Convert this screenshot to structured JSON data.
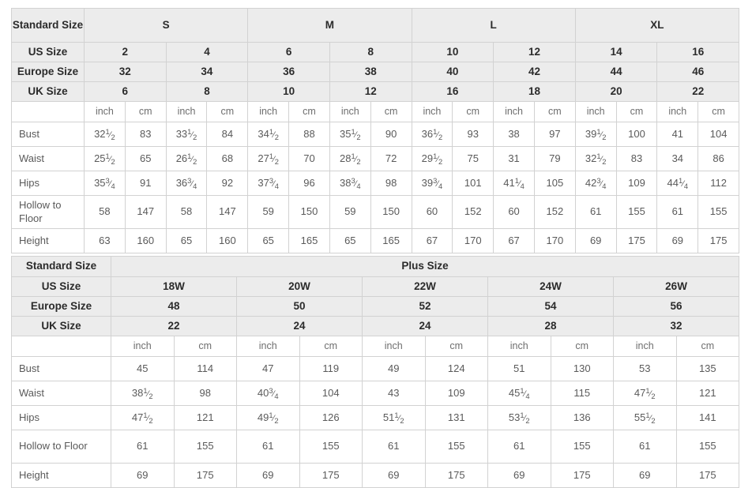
{
  "tables": [
    {
      "name": "standard-size-chart",
      "header_rows": [
        {
          "label": "Standard Size",
          "groups": [
            {
              "label": "S",
              "span": 4
            },
            {
              "label": "M",
              "span": 4
            },
            {
              "label": "L",
              "span": 4
            },
            {
              "label": "XL",
              "span": 4
            }
          ]
        },
        {
          "label": "US Size",
          "values": [
            "2",
            "4",
            "6",
            "8",
            "10",
            "12",
            "14",
            "16"
          ]
        },
        {
          "label": "Europe Size",
          "values": [
            "32",
            "34",
            "36",
            "38",
            "40",
            "42",
            "44",
            "46"
          ]
        },
        {
          "label": "UK Size",
          "values": [
            "6",
            "8",
            "10",
            "12",
            "16",
            "18",
            "20",
            "22"
          ]
        }
      ],
      "unit_row": {
        "label": "",
        "units": [
          "inch",
          "cm",
          "inch",
          "cm",
          "inch",
          "cm",
          "inch",
          "cm",
          "inch",
          "cm",
          "inch",
          "cm",
          "inch",
          "cm",
          "inch",
          "cm"
        ]
      },
      "rows": [
        {
          "label": "Bust",
          "tall": false,
          "cells": [
            {
              "whole": "32",
              "num": "1",
              "den": "2"
            },
            {
              "whole": "83"
            },
            {
              "whole": "33",
              "num": "1",
              "den": "2"
            },
            {
              "whole": "84"
            },
            {
              "whole": "34",
              "num": "1",
              "den": "2"
            },
            {
              "whole": "88"
            },
            {
              "whole": "35",
              "num": "1",
              "den": "2"
            },
            {
              "whole": "90"
            },
            {
              "whole": "36",
              "num": "1",
              "den": "2"
            },
            {
              "whole": "93"
            },
            {
              "whole": "38"
            },
            {
              "whole": "97"
            },
            {
              "whole": "39",
              "num": "1",
              "den": "2"
            },
            {
              "whole": "100"
            },
            {
              "whole": "41"
            },
            {
              "whole": "104"
            }
          ]
        },
        {
          "label": "Waist",
          "tall": false,
          "cells": [
            {
              "whole": "25",
              "num": "1",
              "den": "2"
            },
            {
              "whole": "65"
            },
            {
              "whole": "26",
              "num": "1",
              "den": "2"
            },
            {
              "whole": "68"
            },
            {
              "whole": "27",
              "num": "1",
              "den": "2"
            },
            {
              "whole": "70"
            },
            {
              "whole": "28",
              "num": "1",
              "den": "2"
            },
            {
              "whole": "72"
            },
            {
              "whole": "29",
              "num": "1",
              "den": "2"
            },
            {
              "whole": "75"
            },
            {
              "whole": "31"
            },
            {
              "whole": "79"
            },
            {
              "whole": "32",
              "num": "1",
              "den": "2"
            },
            {
              "whole": "83"
            },
            {
              "whole": "34"
            },
            {
              "whole": "86"
            }
          ]
        },
        {
          "label": "Hips",
          "tall": false,
          "cells": [
            {
              "whole": "35",
              "num": "3",
              "den": "4"
            },
            {
              "whole": "91"
            },
            {
              "whole": "36",
              "num": "3",
              "den": "4"
            },
            {
              "whole": "92"
            },
            {
              "whole": "37",
              "num": "3",
              "den": "4"
            },
            {
              "whole": "96"
            },
            {
              "whole": "38",
              "num": "3",
              "den": "4"
            },
            {
              "whole": "98"
            },
            {
              "whole": "39",
              "num": "3",
              "den": "4"
            },
            {
              "whole": "101"
            },
            {
              "whole": "41",
              "num": "1",
              "den": "4"
            },
            {
              "whole": "105"
            },
            {
              "whole": "42",
              "num": "3",
              "den": "4"
            },
            {
              "whole": "109"
            },
            {
              "whole": "44",
              "num": "1",
              "den": "4"
            },
            {
              "whole": "112"
            }
          ]
        },
        {
          "label": "Hollow to Floor",
          "tall": true,
          "cells": [
            {
              "whole": "58"
            },
            {
              "whole": "147"
            },
            {
              "whole": "58"
            },
            {
              "whole": "147"
            },
            {
              "whole": "59"
            },
            {
              "whole": "150"
            },
            {
              "whole": "59"
            },
            {
              "whole": "150"
            },
            {
              "whole": "60"
            },
            {
              "whole": "152"
            },
            {
              "whole": "60"
            },
            {
              "whole": "152"
            },
            {
              "whole": "61"
            },
            {
              "whole": "155"
            },
            {
              "whole": "61"
            },
            {
              "whole": "155"
            }
          ]
        },
        {
          "label": "Height",
          "tall": false,
          "cells": [
            {
              "whole": "63"
            },
            {
              "whole": "160"
            },
            {
              "whole": "65"
            },
            {
              "whole": "160"
            },
            {
              "whole": "65"
            },
            {
              "whole": "165"
            },
            {
              "whole": "65"
            },
            {
              "whole": "165"
            },
            {
              "whole": "67"
            },
            {
              "whole": "170"
            },
            {
              "whole": "67"
            },
            {
              "whole": "170"
            },
            {
              "whole": "69"
            },
            {
              "whole": "175"
            },
            {
              "whole": "69"
            },
            {
              "whole": "175"
            }
          ]
        }
      ]
    },
    {
      "name": "plus-size-chart",
      "header_rows": [
        {
          "label": "Standard Size",
          "groups": [
            {
              "label": "Plus Size",
              "span": 10
            }
          ]
        },
        {
          "label": "US Size",
          "values": [
            "18W",
            "20W",
            "22W",
            "24W",
            "26W"
          ]
        },
        {
          "label": "Europe Size",
          "values": [
            "48",
            "50",
            "52",
            "54",
            "56"
          ]
        },
        {
          "label": "UK Size",
          "values": [
            "22",
            "24",
            "24",
            "28",
            "32"
          ]
        }
      ],
      "unit_row": {
        "label": "",
        "units": [
          "inch",
          "cm",
          "inch",
          "cm",
          "inch",
          "cm",
          "inch",
          "cm",
          "inch",
          "cm"
        ]
      },
      "rows": [
        {
          "label": "Bust",
          "tall": false,
          "cells": [
            {
              "whole": "45"
            },
            {
              "whole": "114"
            },
            {
              "whole": "47"
            },
            {
              "whole": "119"
            },
            {
              "whole": "49"
            },
            {
              "whole": "124"
            },
            {
              "whole": "51"
            },
            {
              "whole": "130"
            },
            {
              "whole": "53"
            },
            {
              "whole": "135"
            }
          ]
        },
        {
          "label": "Waist",
          "tall": false,
          "cells": [
            {
              "whole": "38",
              "num": "1",
              "den": "2"
            },
            {
              "whole": "98"
            },
            {
              "whole": "40",
              "num": "3",
              "den": "4"
            },
            {
              "whole": "104"
            },
            {
              "whole": "43"
            },
            {
              "whole": "109"
            },
            {
              "whole": "45",
              "num": "1",
              "den": "4"
            },
            {
              "whole": "115"
            },
            {
              "whole": "47",
              "num": "1",
              "den": "2"
            },
            {
              "whole": "121"
            }
          ]
        },
        {
          "label": "Hips",
          "tall": false,
          "cells": [
            {
              "whole": "47",
              "num": "1",
              "den": "2"
            },
            {
              "whole": "121"
            },
            {
              "whole": "49",
              "num": "1",
              "den": "2"
            },
            {
              "whole": "126"
            },
            {
              "whole": "51",
              "num": "1",
              "den": "2"
            },
            {
              "whole": "131"
            },
            {
              "whole": "53",
              "num": "1",
              "den": "2"
            },
            {
              "whole": "136"
            },
            {
              "whole": "55",
              "num": "1",
              "den": "2"
            },
            {
              "whole": "141"
            }
          ]
        },
        {
          "label": "Hollow to Floor",
          "tall": true,
          "cells": [
            {
              "whole": "61"
            },
            {
              "whole": "155"
            },
            {
              "whole": "61"
            },
            {
              "whole": "155"
            },
            {
              "whole": "61"
            },
            {
              "whole": "155"
            },
            {
              "whole": "61"
            },
            {
              "whole": "155"
            },
            {
              "whole": "61"
            },
            {
              "whole": "155"
            }
          ]
        },
        {
          "label": "Height",
          "tall": false,
          "cells": [
            {
              "whole": "69"
            },
            {
              "whole": "175"
            },
            {
              "whole": "69"
            },
            {
              "whole": "175"
            },
            {
              "whole": "69"
            },
            {
              "whole": "175"
            },
            {
              "whole": "69"
            },
            {
              "whole": "175"
            },
            {
              "whole": "69"
            },
            {
              "whole": "175"
            }
          ]
        }
      ]
    }
  ],
  "colors": {
    "header_bg": "#ececec",
    "border": "#d2d2d2",
    "header_text": "#2b2b2b",
    "body_text": "#5a5a5a",
    "page_bg": "#ffffff"
  }
}
